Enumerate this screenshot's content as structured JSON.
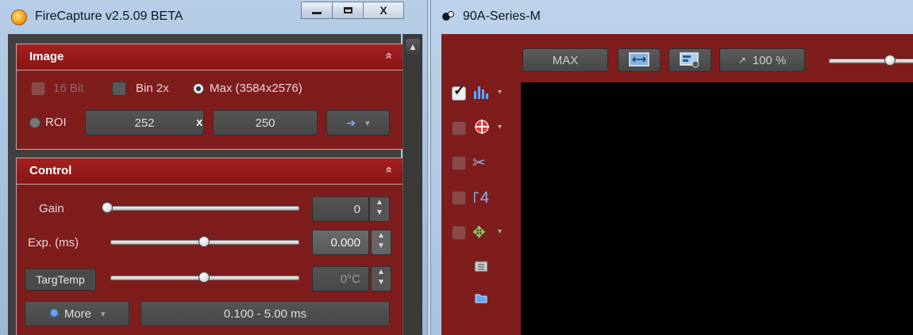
{
  "app": {
    "title": "FireCapture v2.5.09 BETA",
    "icon": "firecapture-app-icon",
    "caption": {
      "minimize": "minimize-icon",
      "maximize": "maximize-icon",
      "close": "X"
    }
  },
  "image_panel": {
    "title": "Image",
    "collapse_icon": "»",
    "bit16_label": "16 Bit",
    "bin_label": "Bin 2x",
    "max_label": "Max (3584x2576)",
    "roi_label": "ROI",
    "roi_width": "252",
    "roi_x": "x",
    "roi_height": "250",
    "apply_icon": "➔",
    "dropdown_icon": "▾"
  },
  "control_panel": {
    "title": "Control",
    "collapse_icon": "»",
    "gain_label": "Gain",
    "gain_value": "0",
    "gain_level": 0.0,
    "exposure_label": "Exp. (ms)",
    "exposure_value": "0.000",
    "exposure_level": 0.5,
    "targtemp_label": "TargTemp",
    "targtemp_value": "0°C",
    "targtemp_level": 0.5,
    "more_label": "More",
    "range_text": "0.100 - 5.00 ms",
    "spin_up": "▲",
    "spin_down": "▼"
  },
  "scrollbar": {
    "up_icon": "▲"
  },
  "viewer_window": {
    "title": "90A-Series-M",
    "toolbar": {
      "max_label": "MAX",
      "fit_icon": "fit-screen-icon",
      "settings_icon": "display-settings-icon",
      "zoom_label": "100 %",
      "zoom_slider_level": 0.7
    },
    "tools": [
      {
        "name": "histogram",
        "icon": "📊",
        "checked": true
      },
      {
        "name": "crosshair",
        "icon": "⊕",
        "checked": false
      },
      {
        "name": "scissors",
        "icon": "✂",
        "checked": false
      },
      {
        "name": "focus",
        "icon": "⚏",
        "checked": false
      },
      {
        "name": "tracking",
        "icon": "✥",
        "checked": false
      }
    ]
  },
  "colors": {
    "panel_red": "#7f1d1d",
    "header_red": "#a32121",
    "dark": "#404040",
    "field": "#555555"
  }
}
